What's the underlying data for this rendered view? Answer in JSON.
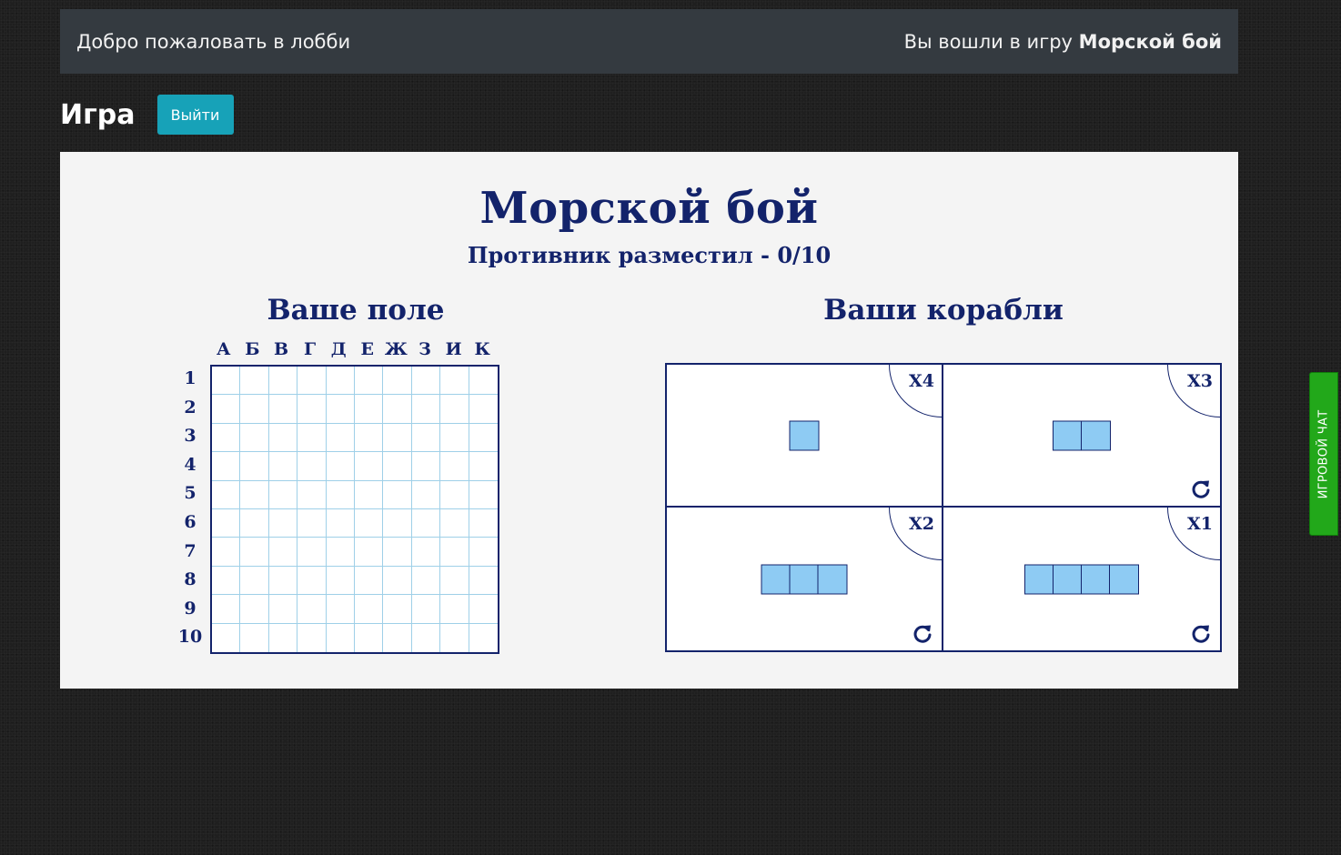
{
  "topbar": {
    "welcome": "Добро пожаловать в лобби",
    "joined_prefix": "Вы вошли в игру",
    "joined_game": "Морской бой"
  },
  "game": {
    "title": "Игра",
    "exit_label": "Выйти"
  },
  "board": {
    "title": "Морской бой",
    "opponent_status": "Противник разместил - 0/10",
    "your_field_title": "Ваше поле",
    "your_ships_title": "Ваши корабли",
    "columns": [
      "А",
      "Б",
      "В",
      "Г",
      "Д",
      "Е",
      "Ж",
      "З",
      "И",
      "К"
    ],
    "rows": [
      "1",
      "2",
      "3",
      "4",
      "5",
      "6",
      "7",
      "8",
      "9",
      "10"
    ]
  },
  "ships": [
    {
      "count": "X4",
      "size": 1,
      "rotatable": false
    },
    {
      "count": "X3",
      "size": 2,
      "rotatable": true
    },
    {
      "count": "X2",
      "size": 3,
      "rotatable": true
    },
    {
      "count": "X1",
      "size": 4,
      "rotatable": true
    }
  ],
  "chat_tab": {
    "label": "ИГРОВОЙ ЧАТ"
  },
  "colors": {
    "navy": "#13236b",
    "deck": "#8ecbf3",
    "grid_line": "#9fd0e8",
    "exit_button": "#17a2b8",
    "chat_tab": "#22a81a"
  },
  "icons": {
    "rotate": "rotate-icon"
  }
}
